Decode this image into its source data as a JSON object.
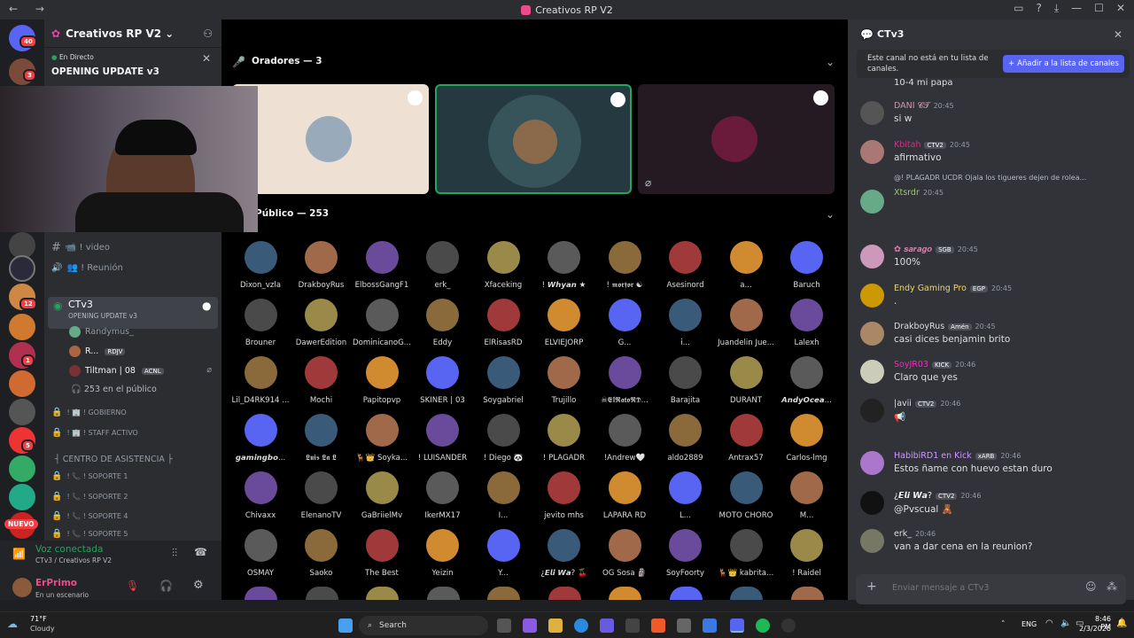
{
  "window": {
    "title": "Creativos RP V2"
  },
  "server": {
    "name": "Creativos RP V2",
    "live_label": "En Directo",
    "live_title": "OPENING UPDATE v3"
  },
  "channels": {
    "video": "video",
    "reunion": "Reunión",
    "ctv3": {
      "name": "CTv3",
      "sub": "OPENING UPDATE v3",
      "users": [
        "Randymus_",
        "R...",
        "Tiltman | 08"
      ],
      "tags": [
        "RDJV",
        "ACNL"
      ],
      "public": "253 en el público"
    },
    "locked": [
      "GOBIERNO",
      "STAFF ACTIVO"
    ],
    "category": "┤ CENTRO DE ASISTENCIA ├",
    "soporte": [
      "SOPORTE 1",
      "SOPORTE 2",
      "SOPORTE 4",
      "SOPORTE 5"
    ]
  },
  "rail": {
    "badges": [
      "40",
      "3",
      "12",
      "1",
      "5"
    ],
    "new": "NUEVO"
  },
  "voice": {
    "status": "Voz conectada",
    "location": "CTv3 / Creativos RP V2",
    "user": "ErPrimo",
    "user_status": "En un escenario"
  },
  "stage": {
    "speakers_label": "Oradores — 3",
    "public_label": "Público — 253",
    "audience": [
      [
        "Dixon_vzla",
        "DrakboyRus",
        "ElbossGangF1",
        "erk_",
        "Xfaceking",
        "! 𝙒𝙝𝙮𝙖𝙣 ★",
        "! 𝖒𝖔𝖗𝖋𝖔𝖗 ☯",
        "Asesinord",
        "a...",
        "Baruch"
      ],
      [
        "Brouner",
        "DawerEdition",
        "DominicanoG...",
        "Eddy",
        "ElRisasRD",
        "ELVIEJORP",
        "G...",
        "i...",
        "Juandelin Jue...",
        "Lalexh"
      ],
      [
        "Lil_D4RK914 ...",
        "Mochi",
        "Papitopvp",
        "SKINER | 03",
        "Soygabriel",
        "Trujillo",
        "☠𝕰𝖑𝕽𝖆𝖙𝖔𝕽𝕯...",
        "Barajita",
        "DURANT",
        "𝘼𝙣𝙙𝙮𝙊𝙘𝙚𝙖..."
      ],
      [
        "𝙜𝙖𝙢𝙞𝙣𝙜𝙗𝙤...",
        "𝕷𝖚𝖎𝖘 𝕷𝖆 𝕷",
        "🦌👑 Soyka...",
        "! LUISANDER",
        "! Diego 🐼",
        "! PLAGADR",
        "!Andrew🤍",
        "aldo2889",
        "Antrax57",
        "Carlos-lmg"
      ],
      [
        "Chivaxx",
        "ElenanoTV",
        "GaBriielMv",
        "IkerMX17",
        "I...",
        "jevito mhs",
        "LAPARA RD",
        "L...",
        "MOTO CHORO",
        "M..."
      ],
      [
        "OSMAY",
        "Saoko",
        "The Best",
        "Yeizin",
        "Y...",
        "¿𝙀𝙡𝙞 𝙒𝙖? 🍒",
        "OG Sosa 🗿",
        "SoyFoorty",
        "🦌👑 kabrita...",
        "! Raidel"
      ]
    ]
  },
  "chat": {
    "channel": "CTv3",
    "notice": "Este canal no está en tu lista de canales.",
    "add_button": "Añadir a la lista de canales",
    "top_line": "10-4 mi papa",
    "messages": [
      {
        "name": "DANI 𝓒𝓣",
        "time": "20:45",
        "text": "si w",
        "tag": ""
      },
      {
        "name": "Kbitah",
        "time": "20:45",
        "text": "afirmativo",
        "tag": "CTV2"
      },
      {
        "name": "Xtsrdr",
        "time": "20:45",
        "text": "",
        "tag": "",
        "reply": "@! PLAGADR  UCDR  Ojala los tigueres dejen de rolea..."
      },
      {
        "name": "✿ 𝒔𝒂𝒓𝒂𝒈𝒐",
        "time": "20:45",
        "text": "100%",
        "tag": "SGB"
      },
      {
        "name": "Endy Gaming Pro",
        "time": "20:45",
        "text": ".",
        "tag": "EGP"
      },
      {
        "name": "DrakboyRus",
        "time": "20:45",
        "text": "casi dices benjamin brito",
        "tag": "Amén"
      },
      {
        "name": "SoyJR03",
        "time": "20:46",
        "text": "Claro que yes",
        "tag": "KICK"
      },
      {
        "name": "|avii",
        "time": "20:46",
        "text": "📢",
        "tag": "CTV2"
      },
      {
        "name": "HabibiRD1 en Kick",
        "time": "20:46",
        "text": "Estos ñame con huevo estan duro",
        "tag": "xARB"
      },
      {
        "name": "¿𝙀𝙡𝙞 𝙒𝙖?",
        "time": "20:46",
        "text": "@Pvscual 🧸",
        "tag": "CTV2"
      },
      {
        "name": "erk_",
        "time": "20:46",
        "text": "van a dar cena en la reunion?",
        "tag": ""
      }
    ],
    "input_placeholder": "Enviar mensaje a CTv3"
  },
  "taskbar": {
    "weather_temp": "71°F",
    "weather_desc": "Cloudy",
    "search": "Search",
    "lang": "ENG",
    "time": "8:46 PM",
    "date": "2/3/2026"
  },
  "colors": {
    "accent": "#5865f2",
    "live": "#23a55a",
    "danger": "#f23f43",
    "bg": "#313338"
  }
}
